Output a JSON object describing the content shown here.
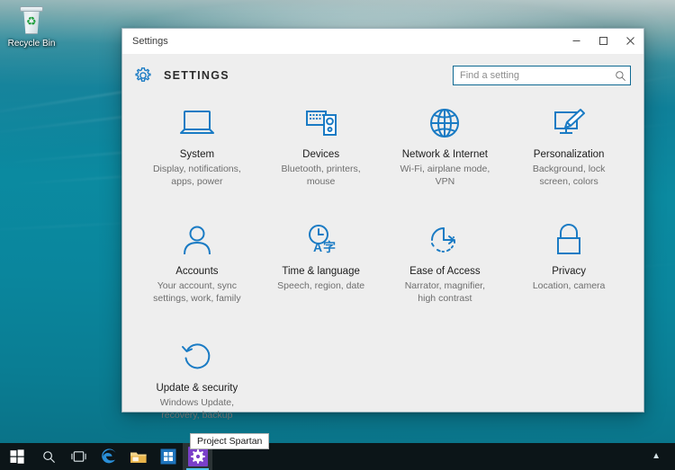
{
  "desktop": {
    "recycle_bin": {
      "label": "Recycle Bin",
      "icon": "recycle-bin-icon"
    }
  },
  "window": {
    "title": "Settings",
    "heading": "SETTINGS",
    "gear_icon": "gear-icon",
    "controls": {
      "minimize": "minimize-button",
      "maximize": "maximize-button",
      "close": "close-button"
    }
  },
  "search": {
    "placeholder": "Find a setting",
    "value": "",
    "icon": "search-icon"
  },
  "tiles": [
    {
      "icon": "laptop-icon",
      "title": "System",
      "desc": "Display, notifications,\napps, power"
    },
    {
      "icon": "devices-icon",
      "title": "Devices",
      "desc": "Bluetooth, printers,\nmouse"
    },
    {
      "icon": "globe-icon",
      "title": "Network & Internet",
      "desc": "Wi-Fi, airplane mode,\nVPN"
    },
    {
      "icon": "paintbrush-monitor-icon",
      "title": "Personalization",
      "desc": "Background, lock\nscreen, colors"
    },
    {
      "icon": "person-icon",
      "title": "Accounts",
      "desc": "Your account, sync\nsettings, work, family"
    },
    {
      "icon": "clock-language-icon",
      "title": "Time & language",
      "desc": "Speech, region, date"
    },
    {
      "icon": "ease-of-access-clock-icon",
      "title": "Ease of Access",
      "desc": "Narrator, magnifier,\nhigh contrast"
    },
    {
      "icon": "lock-icon",
      "title": "Privacy",
      "desc": "Location, camera"
    },
    {
      "icon": "refresh-circle-icon",
      "title": "Update & security",
      "desc": "Windows Update,\nrecovery, backup"
    }
  ],
  "tooltip": {
    "text": "Project Spartan"
  },
  "taskbar": {
    "start": "start-button",
    "search": "search-taskbar-button",
    "task_view": "task-view-button",
    "edge": "edge-browser-button",
    "file_explorer": "file-explorer-button",
    "store": "store-button",
    "settings": "settings-taskbar-button",
    "tray_chevron": "▲"
  },
  "colors": {
    "accent_blue": "#0f6cbd",
    "icon_blue": "#1a7bc4",
    "window_bg": "#eeeeee",
    "titlebar_bg": "#ffffff",
    "taskbar_bg": "#0c1518",
    "settings_tile_purple": "#7a3fc9",
    "active_underline": "#4fc3e8"
  }
}
